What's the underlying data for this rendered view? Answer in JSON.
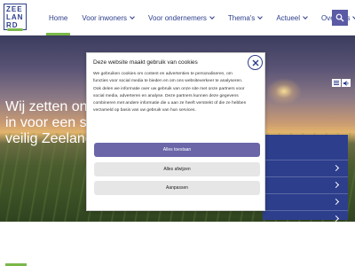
{
  "header": {
    "logo": {
      "line1": "ZEE",
      "line2": "LAN",
      "line3": "RD"
    },
    "nav": [
      {
        "label": "Home",
        "active": true,
        "dropdown": false
      },
      {
        "label": "Voor inwoners",
        "active": false,
        "dropdown": true
      },
      {
        "label": "Voor ondernemers",
        "active": false,
        "dropdown": true
      },
      {
        "label": "Thema's",
        "active": false,
        "dropdown": true
      },
      {
        "label": "Actueel",
        "active": false,
        "dropdown": true
      },
      {
        "label": "Over ons",
        "active": false,
        "dropdown": true
      }
    ],
    "search_icon": "search-icon"
  },
  "hero": {
    "title_lines": [
      "Wij zetten ons",
      "in voor een sc",
      "veilig Zeeland"
    ]
  },
  "cookie_modal": {
    "title": "Deze website maakt gebruik van cookies",
    "body_lines": [
      "We gebruiken cookies om content en advertenties te personaliseren, om",
      "functies voor social media te bieden en om ons websiteverkeer te analyseren.",
      "Ook delen we informatie over uw gebruik van onze site met onze partners voor",
      "social media, adverteren en analyse. Deze partners kunnen deze gegevens",
      "combineren met andere informatie die u aan ze heeft verstrekt of die ze hebben",
      "verzameld op basis van uw gebruik van hun services."
    ],
    "accept_all_label": "Alles toestaan",
    "reject_all_label": "Alles afwijzen",
    "customize_label": "Aanpassen"
  },
  "colors": {
    "brand_blue": "#2d3e8c",
    "accent_green": "#7bb84a",
    "primary_button": "#6a66a8",
    "search_button": "#5a5aa6"
  }
}
